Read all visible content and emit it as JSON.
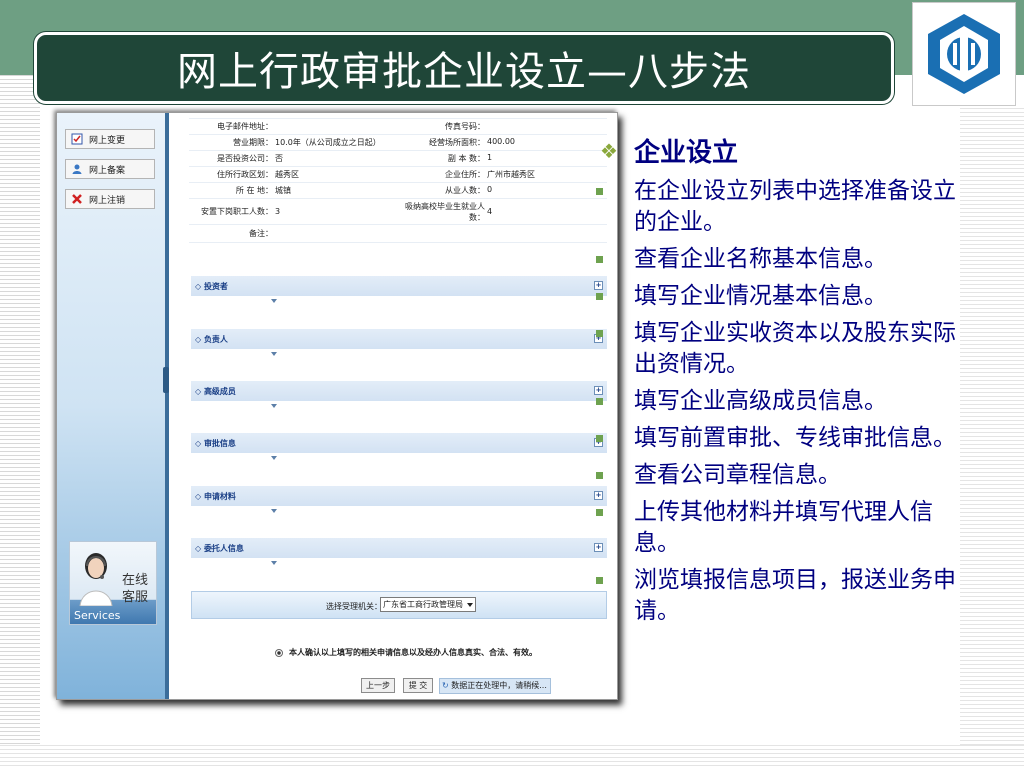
{
  "slide": {
    "title": "网上行政审批企业设立—八步法"
  },
  "logo": {
    "icon": "company-logo-icon",
    "colors": {
      "outer": "#1a6fb3",
      "inner": "#ffffff"
    }
  },
  "screenshot": {
    "nav": [
      {
        "label": "网上变更",
        "icon": "checklist-icon"
      },
      {
        "label": "网上备案",
        "icon": "person-icon"
      },
      {
        "label": "网上注销",
        "icon": "cancel-icon"
      }
    ],
    "service": {
      "line1": "在线",
      "line2": "客服",
      "label_en": "Services"
    },
    "info_rows": [
      {
        "l1": "电子邮件地址：",
        "v1": "",
        "l2": "传真号码：",
        "v2": ""
      },
      {
        "l1": "营业期限：",
        "v1": "10.0年（从公司成立之日起）",
        "l2": "经营场所面积：",
        "v2": "400.00"
      },
      {
        "l1": "是否投资公司：",
        "v1": "否",
        "l2": "副 本 数：",
        "v2": "1"
      },
      {
        "l1": "住所行政区划：",
        "v1": "越秀区",
        "l2": "企业住所：",
        "v2": "广州市越秀区"
      },
      {
        "l1": "所 在 地：",
        "v1": "城镇",
        "l2": "从业人数：",
        "v2": "0"
      },
      {
        "l1": "安置下岗职工人数：",
        "v1": "3",
        "l2": "吸纳高校毕业生就业人数：",
        "v2": "4"
      },
      {
        "l1": "备注：",
        "v1": "",
        "l2": "",
        "v2": ""
      }
    ],
    "sections": [
      "◇ 投资者",
      "◇ 负责人",
      "◇ 高级成员",
      "◇ 审批信息",
      "◇ 申请材料",
      "◇ 委托人信息"
    ],
    "agency": {
      "label": "选择受理机关：",
      "value": "广东省工商行政管理局"
    },
    "confirm_text": "本人确认以上填写的相关申请信息以及经办人信息真实、合法、有效。",
    "prev_button": "上一步",
    "submit_button": "提 交",
    "status": "数据正在处理中，请稍候..."
  },
  "content": {
    "heading": "企业设立",
    "bullets": [
      "在企业设立列表中选择准备设立的企业。",
      "查看企业名称基本信息。",
      "填写企业情况基本信息。",
      "填写企业实收资本以及股东实际出资情况。",
      "填写企业高级成员信息。",
      "填写前置审批、专线审批信息。",
      "查看公司章程信息。",
      "上传其他材料并填写代理人信息。",
      "浏览填报信息项目，报送业务申请。"
    ]
  }
}
